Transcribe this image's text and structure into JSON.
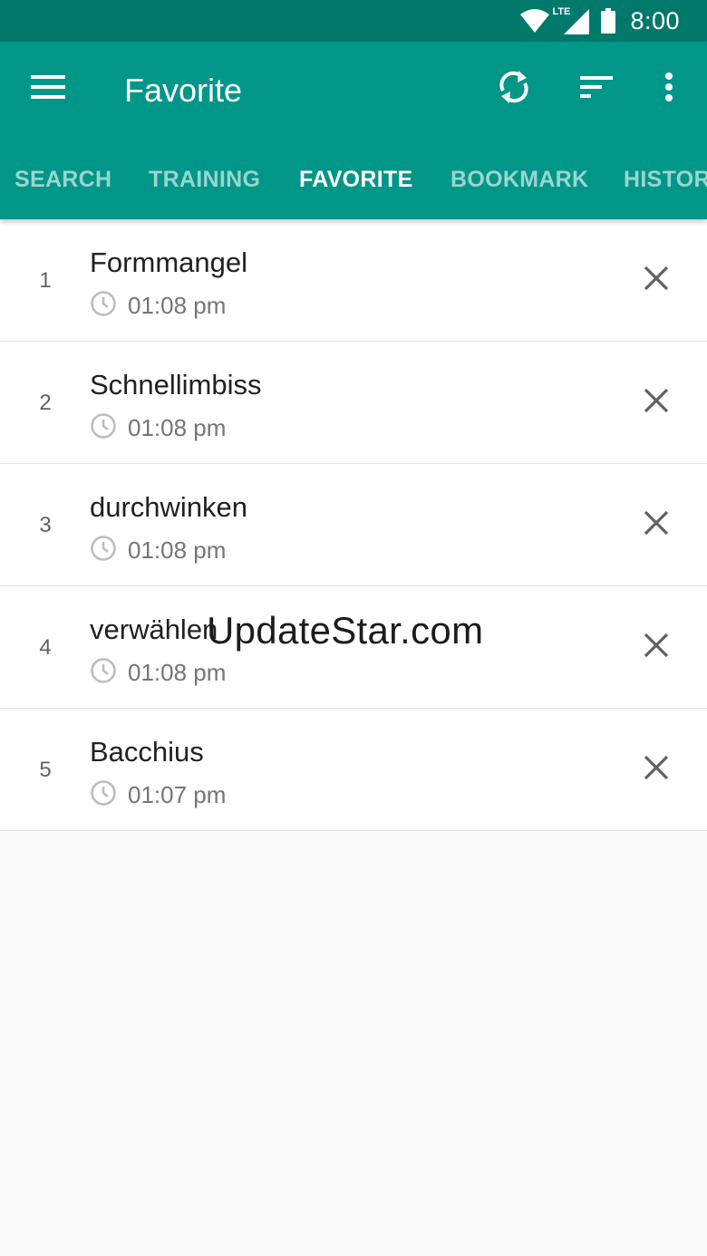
{
  "status_bar": {
    "time": "8:00",
    "network": "LTE",
    "icons": [
      "wifi-icon",
      "lte-signal-icon",
      "battery-icon"
    ]
  },
  "toolbar": {
    "title": "Favorite",
    "icons": [
      "menu-icon",
      "sync-icon",
      "sort-icon",
      "more-vert-icon"
    ]
  },
  "tabs": [
    {
      "label": "SEARCH",
      "active": false
    },
    {
      "label": "TRAINING",
      "active": false
    },
    {
      "label": "FAVORITE",
      "active": true
    },
    {
      "label": "BOOKMARK",
      "active": false
    },
    {
      "label": "HISTORY",
      "active": false
    }
  ],
  "favorites": [
    {
      "index": "1",
      "word": "Formmangel",
      "time": "01:08 pm"
    },
    {
      "index": "2",
      "word": "Schnellimbiss",
      "time": "01:08 pm"
    },
    {
      "index": "3",
      "word": "durchwinken",
      "time": "01:08 pm"
    },
    {
      "index": "4",
      "word": "verwählen",
      "time": "01:08 pm"
    },
    {
      "index": "5",
      "word": "Bacchius",
      "time": "01:07 pm"
    }
  ],
  "watermark": "UpdateStar.com",
  "colors": {
    "status_bar": "#00796b",
    "toolbar": "#009688",
    "background": "#fafafa"
  }
}
